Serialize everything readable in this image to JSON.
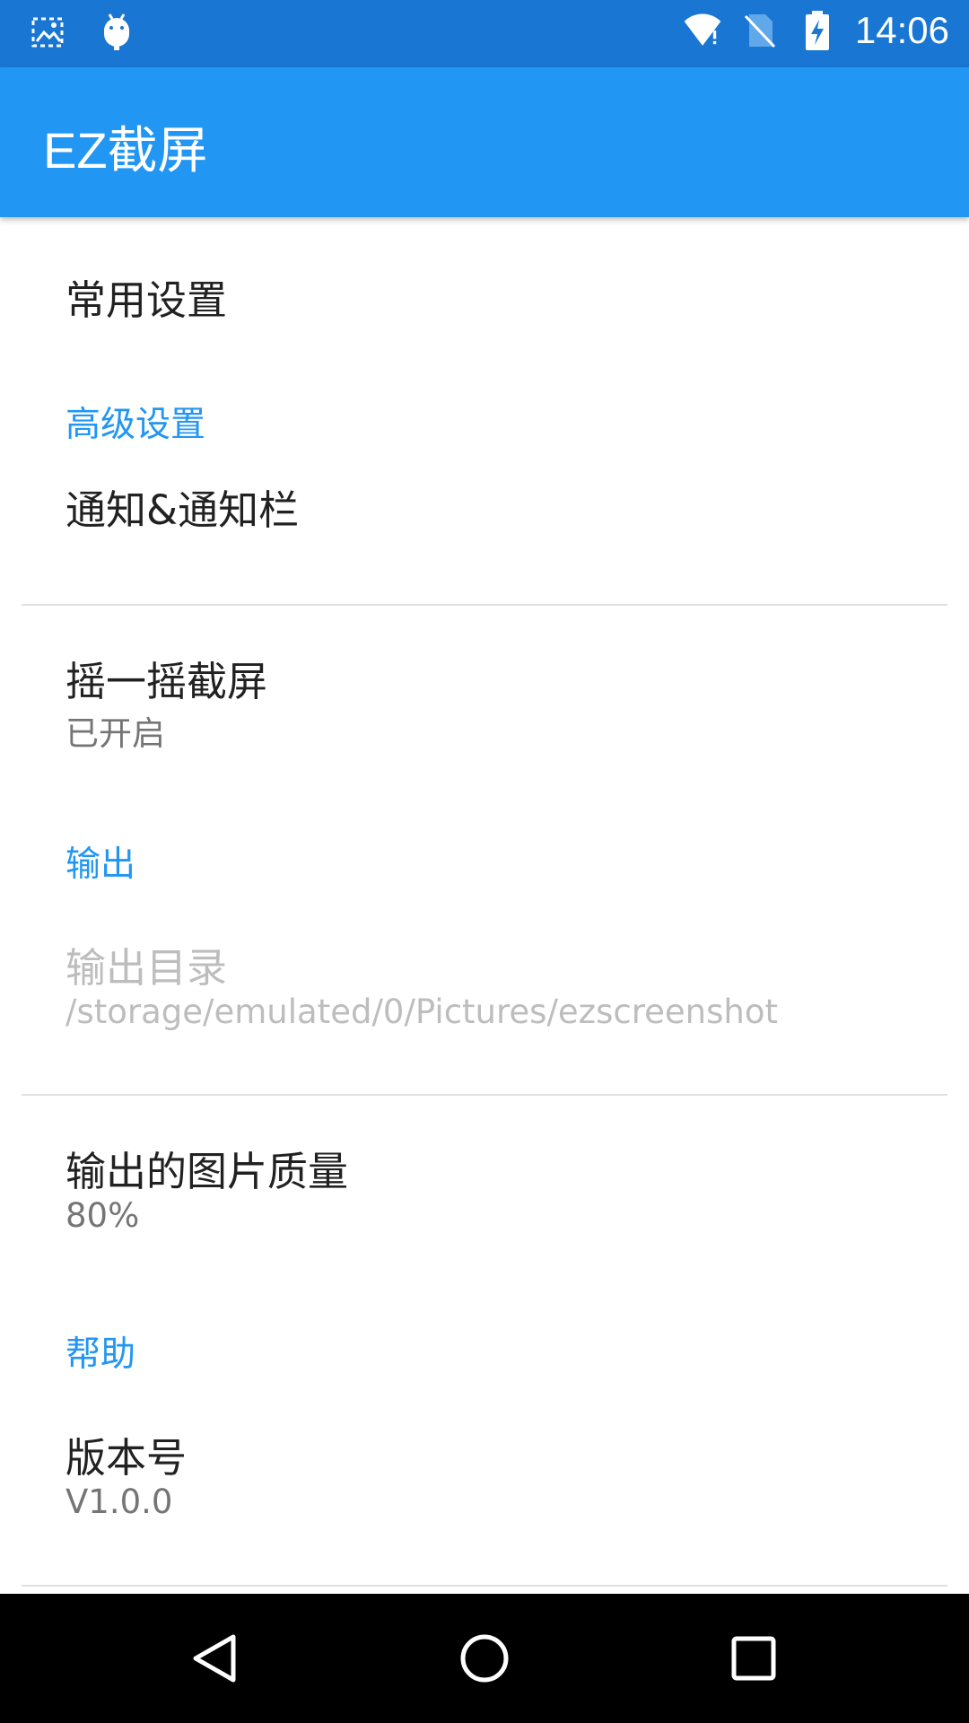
{
  "status_bar": {
    "time": "14:06",
    "left_icons": [
      "screenshot-icon",
      "android-debug-icon"
    ],
    "right_icons": [
      "wifi-icon",
      "no-sim-icon",
      "battery-charging-icon"
    ]
  },
  "app_bar": {
    "title": "EZ截屏"
  },
  "preferences": {
    "common_settings": {
      "title": "常用设置"
    },
    "advanced_category": {
      "title": "高级设置"
    },
    "notifications": {
      "title": "通知&通知栏"
    },
    "shake": {
      "title": "摇一摇截屏",
      "summary": "已开启"
    },
    "output_category": {
      "title": "输出"
    },
    "output_dir": {
      "title": "输出目录",
      "summary": "/storage/emulated/0/Pictures/ezscreenshot",
      "enabled": false
    },
    "image_quality": {
      "title": "输出的图片质量",
      "summary": "80%"
    },
    "help_category": {
      "title": "帮助"
    },
    "version": {
      "title": "版本号",
      "summary": "V1.0.0"
    }
  },
  "nav_bar": {
    "buttons": [
      "back-icon",
      "home-icon",
      "recents-icon"
    ]
  },
  "colors": {
    "status_bar": "#1976D2",
    "app_bar": "#2196F3",
    "accent": "#2196F3"
  }
}
